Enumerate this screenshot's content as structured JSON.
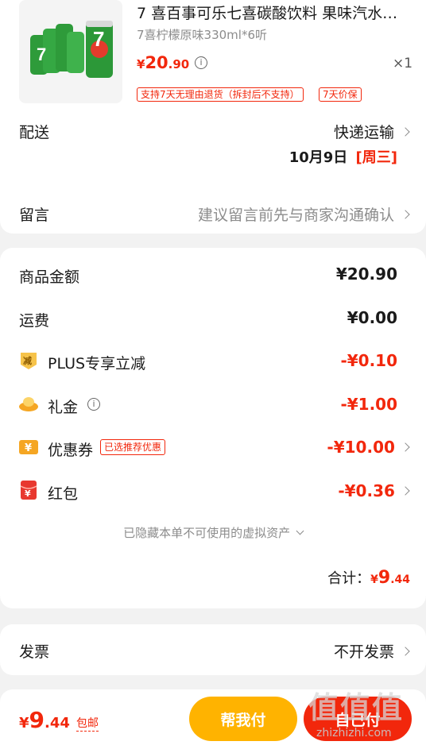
{
  "product": {
    "title": "7 喜百事可乐七喜碳酸饮料 果味汽水…",
    "spec": "7喜柠檬原味330ml*6听",
    "price_symbol": "¥",
    "price_int": "20",
    "price_dec": ".90",
    "quantity": "×1",
    "tags": [
      "支持7天无理由退货（拆封后不支持）",
      "7天价保"
    ],
    "image_icon": "soda-can-pack-image"
  },
  "delivery": {
    "label": "配送",
    "method": "快递运输",
    "date": "10月9日",
    "weekday": "[周三]"
  },
  "message": {
    "label": "留言",
    "placeholder": "建议留言前先与商家沟通确认"
  },
  "summary": {
    "goods_label": "商品金额",
    "goods_value": "¥20.90",
    "shipping_label": "运费",
    "shipping_value": "¥0.00",
    "plus_label": "PLUS专享立减",
    "plus_value": "-¥0.10",
    "plus_icon_text": "减",
    "gift_label": "礼金",
    "gift_value": "-¥1.00",
    "coupon_label": "优惠券",
    "coupon_badge": "已选推荐优惠",
    "coupon_value": "-¥10.00",
    "coupon_icon_text": "¥",
    "redpacket_label": "红包",
    "redpacket_value": "-¥0.36",
    "redpacket_icon_text": "¥",
    "hidden_assets": "已隐藏本单不可使用的虚拟资产",
    "total_label": "合计：",
    "total_symbol": "¥",
    "total_int": "9",
    "total_dec": ".44"
  },
  "invoice": {
    "label": "发票",
    "value": "不开发票"
  },
  "bottom_bar": {
    "symbol": "¥",
    "amount_int": "9",
    "amount_dec": ".44",
    "free_shipping": "包邮",
    "help_pay": "帮我付",
    "self_pay": "自己付"
  },
  "watermark": {
    "text": "值值值",
    "url": "zhizhizhi.com"
  },
  "colors": {
    "accent_red": "#f2270c",
    "help_pay_yellow": "#ffb300",
    "self_pay_red": "#f2270c"
  }
}
